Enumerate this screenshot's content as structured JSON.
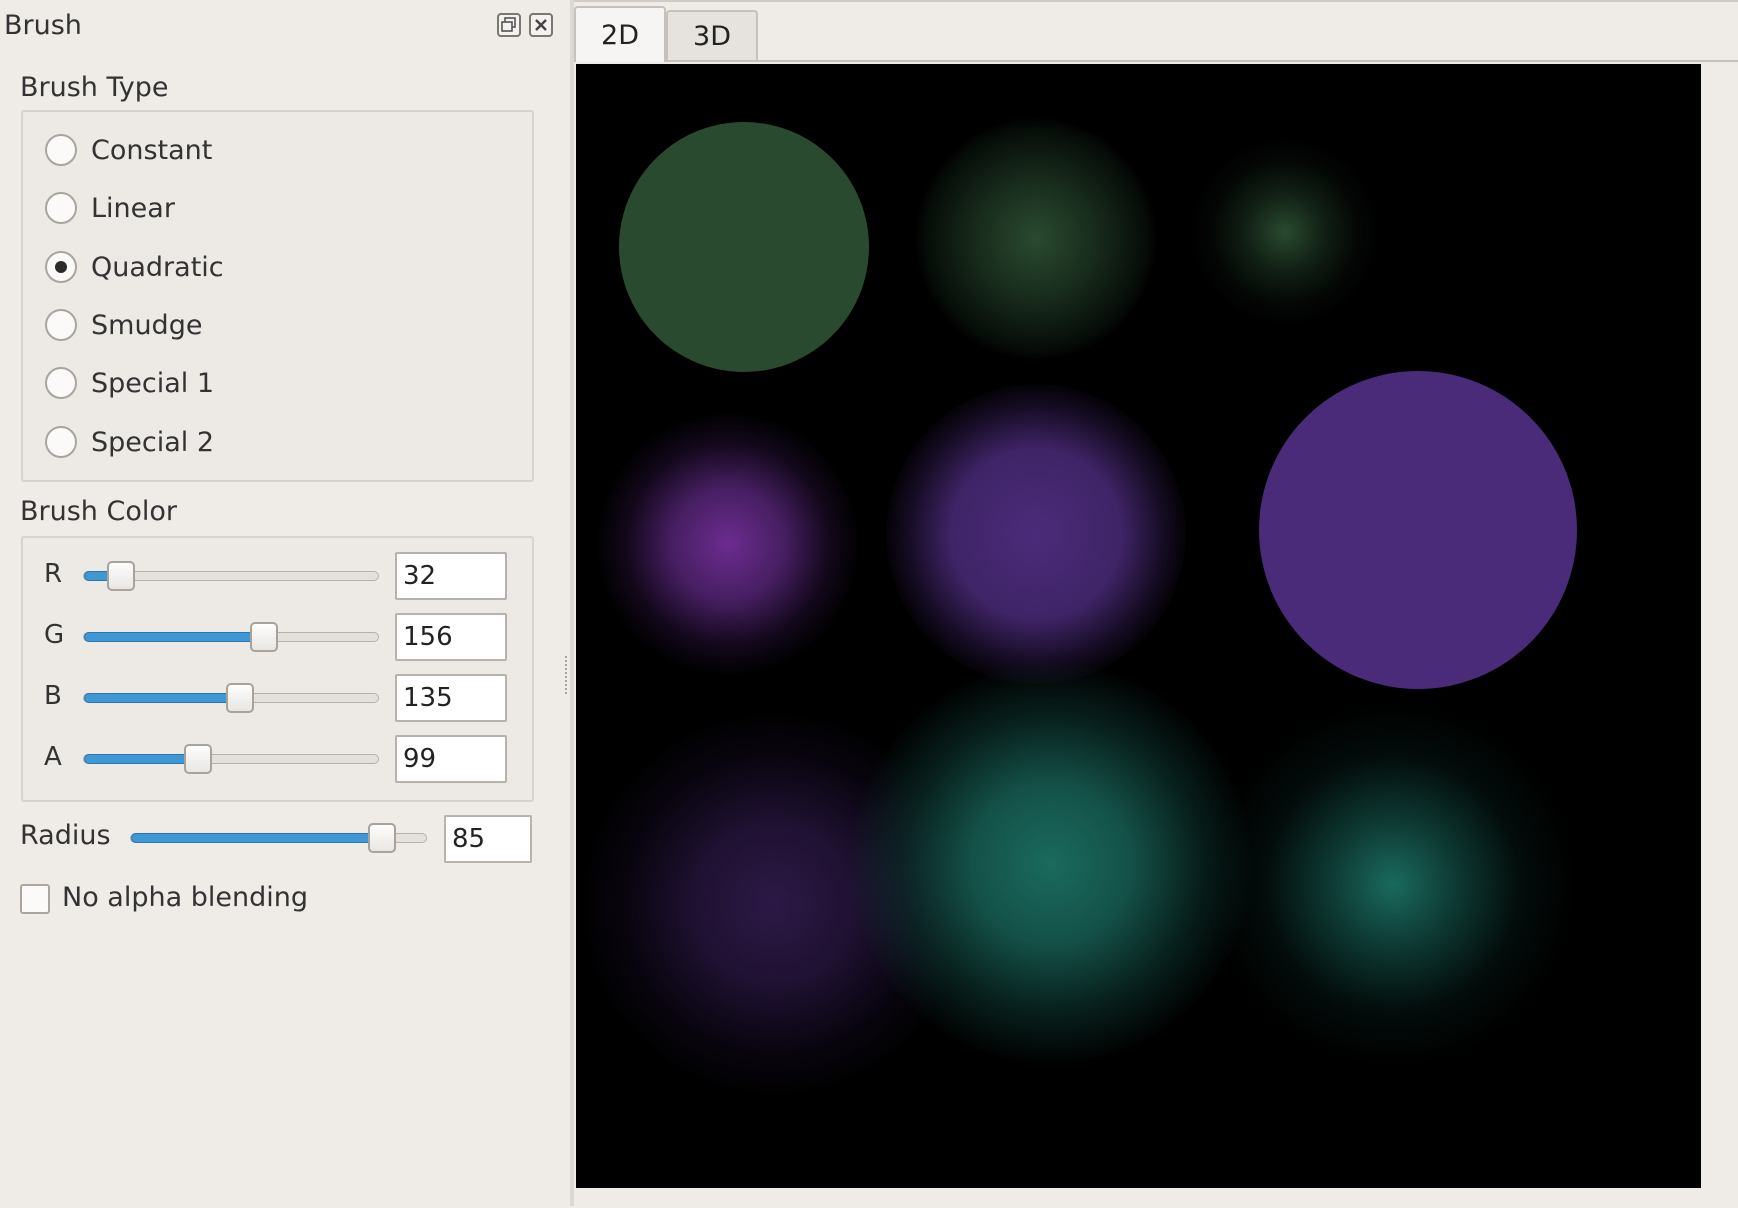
{
  "dock": {
    "title": "Brush",
    "float_icon": "float-icon",
    "close_icon": "close-icon"
  },
  "brush_type": {
    "label": "Brush Type",
    "options": [
      "Constant",
      "Linear",
      "Quadratic",
      "Smudge",
      "Special 1",
      "Special 2"
    ],
    "selected": "Quadratic"
  },
  "brush_color": {
    "label": "Brush Color",
    "channels": [
      {
        "letter": "R",
        "value": "32",
        "fraction": 0.125
      },
      {
        "letter": "G",
        "value": "156",
        "fraction": 0.612
      },
      {
        "letter": "B",
        "value": "135",
        "fraction": 0.529
      },
      {
        "letter": "A",
        "value": "99",
        "fraction": 0.388
      }
    ]
  },
  "radius": {
    "label": "Radius",
    "value": "85",
    "fraction": 0.85
  },
  "no_alpha": {
    "label": "No alpha blending",
    "checked": false
  },
  "tabs": [
    {
      "label": "2D",
      "active": true
    },
    {
      "label": "3D",
      "active": false
    }
  ],
  "colors": {
    "accent": "#3f97d6",
    "canvas_background": "#000000",
    "green": "#294a2f",
    "purple": "#4a2b7a",
    "magenta": "#6a2a8a",
    "dark_purple": "#2a1740",
    "teal": "#1a6a5e"
  }
}
